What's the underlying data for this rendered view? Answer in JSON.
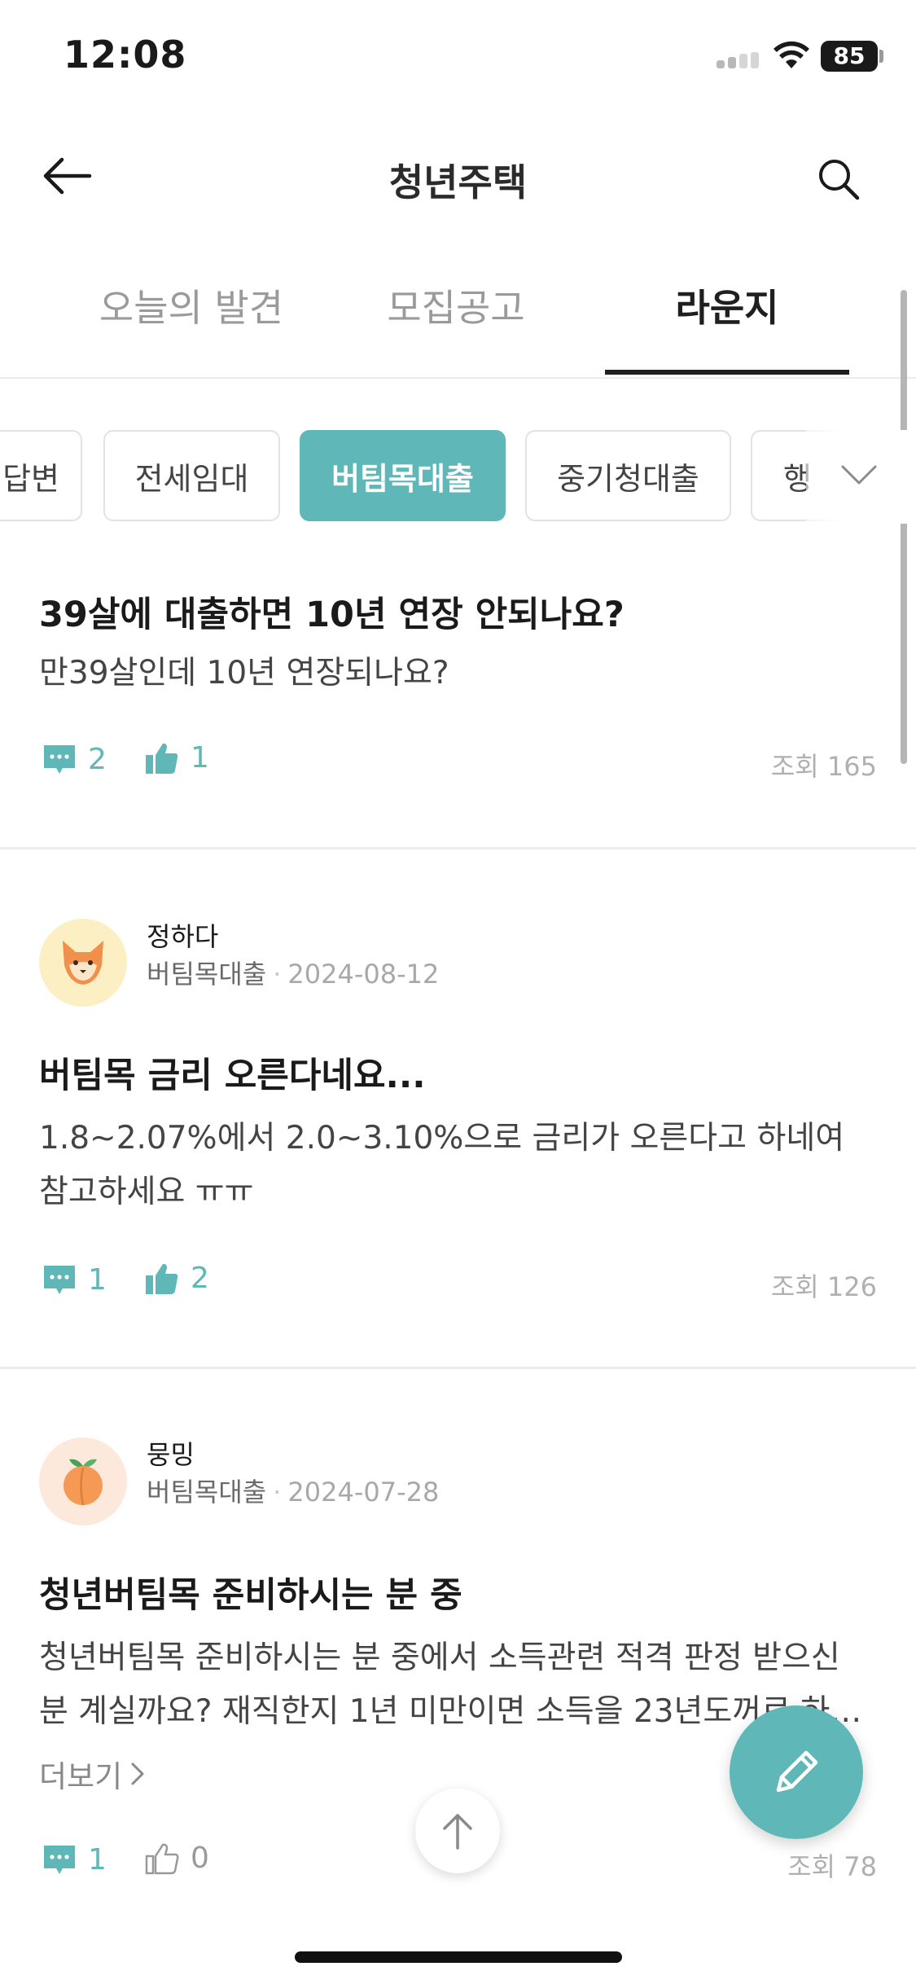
{
  "status_bar": {
    "time": "12:08",
    "battery": "85"
  },
  "header": {
    "title": "청년주택"
  },
  "tabs": [
    {
      "label": "오늘의 발견",
      "active": false
    },
    {
      "label": "모집공고",
      "active": false
    },
    {
      "label": "라운지",
      "active": true
    }
  ],
  "chips": [
    {
      "label": "답변",
      "active": false
    },
    {
      "label": "전세임대",
      "active": false
    },
    {
      "label": "버팀목대출",
      "active": true
    },
    {
      "label": "중기청대출",
      "active": false
    },
    {
      "label": "행",
      "active": false
    }
  ],
  "posts": [
    {
      "title": "39살에 대출하면 10년 연장 안되나요?",
      "body": "만39살인데 10년 연장되나요?",
      "comments": "2",
      "likes": "1",
      "views": "조회 165"
    },
    {
      "author": "정하다",
      "category": "버팀목대출",
      "date": "2024-08-12",
      "avatar_icon": "fox-avatar-icon",
      "title": "버팀목 금리 오른다네요...",
      "body": "1.8~2.07%에서 2.0~3.10%으로 금리가 오른다고 하네여 참고하세요 ㅠㅠ",
      "comments": "1",
      "likes": "2",
      "views": "조회 126"
    },
    {
      "author": "뭉밍",
      "category": "버팀목대출",
      "date": "2024-07-28",
      "avatar_icon": "peach-avatar-icon",
      "title": "청년버팀목 준비하시는 분 중",
      "body": "청년버팀목 준비하시는 분 중에서 소득관련 적격 판정 받으신 분 계실까요? 재직한지 1년 미만이면 소득을 23년도꺼로 하…",
      "more": "더보기",
      "comments": "1",
      "likes": "0",
      "views": "조회 78"
    }
  ],
  "colors": {
    "accent": "#5fb8b7",
    "text": "#1a1a1a",
    "muted": "#9a9a9a"
  }
}
